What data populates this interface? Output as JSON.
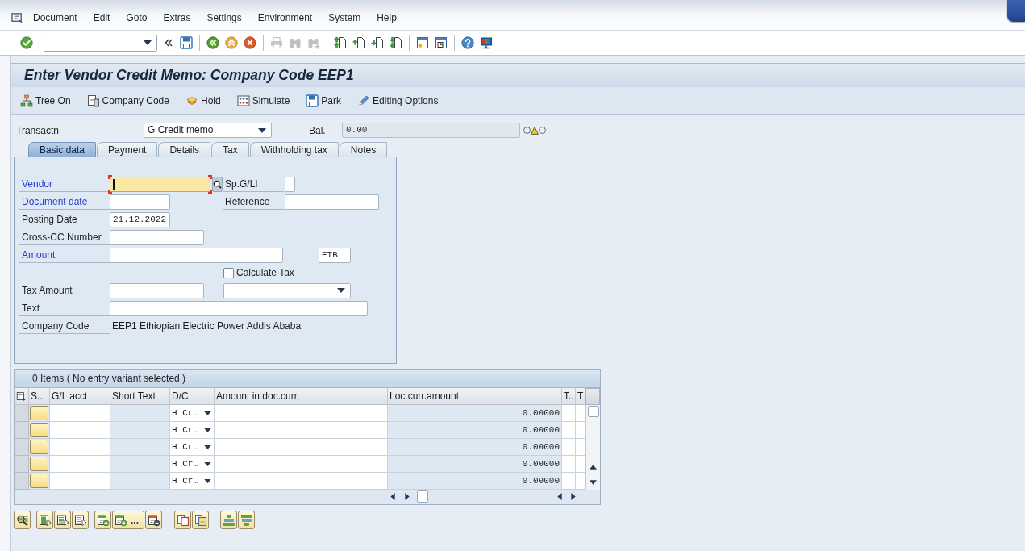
{
  "menu_bar": {
    "items": [
      "Document",
      "Edit",
      "Goto",
      "Extras",
      "Settings",
      "Environment",
      "System",
      "Help"
    ]
  },
  "system_toolbar": [
    [
      {
        "kind": "enter",
        "disabled": false
      },
      {
        "kind": "command_field",
        "disabled": false
      },
      {
        "kind": "hide",
        "disabled": false
      },
      {
        "kind": "save",
        "disabled": false
      }
    ],
    [
      {
        "kind": "back",
        "disabled": false
      },
      {
        "kind": "exit",
        "disabled": false
      },
      {
        "kind": "cancel",
        "disabled": false
      }
    ],
    [
      {
        "kind": "print",
        "disabled": true
      },
      {
        "kind": "find",
        "disabled": true
      },
      {
        "kind": "find_next",
        "disabled": true
      }
    ],
    [
      {
        "kind": "first_page",
        "disabled": false
      },
      {
        "kind": "previous_page",
        "disabled": false
      },
      {
        "kind": "next_page",
        "disabled": false
      },
      {
        "kind": "last_page",
        "disabled": false
      }
    ],
    [
      {
        "kind": "new_session",
        "disabled": false
      },
      {
        "kind": "shortcut",
        "disabled": false
      }
    ],
    [
      {
        "kind": "help",
        "disabled": false
      },
      {
        "kind": "layout",
        "disabled": false
      }
    ]
  ],
  "window": {
    "title": "Enter Vendor Credit Memo: Company Code EEP1"
  },
  "app_toolbar": [
    {
      "kind": "tree",
      "label": "Tree On"
    },
    {
      "kind": "company",
      "label": "Company Code"
    },
    {
      "kind": "hold",
      "label": "Hold"
    },
    {
      "kind": "simulate",
      "label": "Simulate"
    },
    {
      "kind": "park",
      "label": "Park"
    },
    {
      "kind": "edit",
      "label": "Editing Options"
    }
  ],
  "header": {
    "transaction": {
      "label": "Transactn",
      "value": "G Credit memo"
    },
    "balance": {
      "label": "Bal.",
      "value": "0.00"
    },
    "status_lights": [
      {
        "kind": "red",
        "on": false
      },
      {
        "kind": "yellow",
        "on": true
      },
      {
        "kind": "green",
        "on": false
      }
    ]
  },
  "tabs": [
    {
      "label": "Basic data",
      "selected": true
    },
    {
      "label": "Payment",
      "selected": false
    },
    {
      "label": "Details",
      "selected": false
    },
    {
      "label": "Tax",
      "selected": false
    },
    {
      "label": "Withholding tax",
      "selected": false
    },
    {
      "label": "Notes",
      "selected": false
    }
  ],
  "basic_data": {
    "vendor": {
      "label": "Vendor",
      "emphasized": true,
      "focused": true
    },
    "special_gl": {
      "label": "Sp.G/LI",
      "emphasized": false
    },
    "document_date": {
      "label": "Document date",
      "emphasized": true
    },
    "reference": {
      "label": "Reference",
      "emphasized": false
    },
    "posting_date": {
      "label": "Posting Date",
      "emphasized": false,
      "value": "21.12.2022"
    },
    "cross_cc_number": {
      "label": "Cross-CC Number",
      "emphasized": false
    },
    "amount": {
      "label": "Amount",
      "emphasized": true
    },
    "currency": {
      "value": "ETB"
    },
    "calculate_tax": {
      "label": "Calculate Tax",
      "checked": false
    },
    "tax_amount": {
      "label": "Tax Amount",
      "emphasized": false
    },
    "text": {
      "label": "Text",
      "emphasized": false
    },
    "company_code": {
      "label": "Company Code",
      "emphasized": false,
      "value": "EEP1 Ethiopian Electric Power Addis Ababa"
    }
  },
  "items_table": {
    "title": "0 Items ( No entry variant selected )",
    "columns": [
      "S...",
      "G/L acct",
      "Short Text",
      "D/C",
      "Amount in doc.curr.",
      "Loc.curr.amount",
      "T..",
      "T"
    ],
    "rows": [
      {
        "debit_credit": "H Cr…",
        "local_amount": "0.00000"
      },
      {
        "debit_credit": "H Cr…",
        "local_amount": "0.00000"
      },
      {
        "debit_credit": "H Cr…",
        "local_amount": "0.00000"
      },
      {
        "debit_credit": "H Cr…",
        "local_amount": "0.00000"
      },
      {
        "debit_credit": "H Cr…",
        "local_amount": "0.00000"
      }
    ]
  },
  "table_toolbar": [
    [
      {
        "kind": "details"
      }
    ],
    [
      {
        "kind": "select_all"
      },
      {
        "kind": "select_block"
      },
      {
        "kind": "deselect_all"
      }
    ],
    [
      {
        "kind": "insert_row"
      },
      {
        "kind": "insert_rows",
        "label": "..."
      },
      {
        "kind": "delete_row"
      }
    ],
    [
      {
        "kind": "copy"
      },
      {
        "kind": "paste"
      }
    ],
    [
      {
        "kind": "sort_ascending"
      },
      {
        "kind": "sort_descending"
      }
    ]
  ]
}
